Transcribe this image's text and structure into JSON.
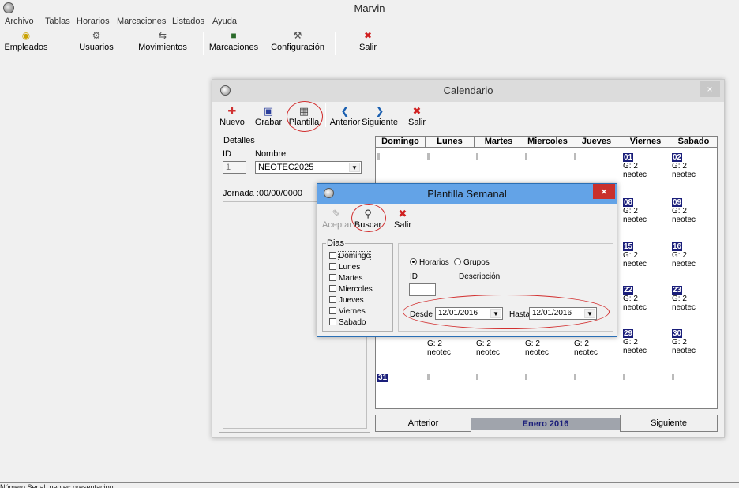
{
  "app": {
    "title": "Marvin"
  },
  "menu": [
    "Archivo",
    "Tablas",
    "Horarios",
    "Marcaciones",
    "Listados",
    "Ayuda"
  ],
  "toolbar": {
    "empleados": "Empleados",
    "usuarios": "Usuarios",
    "movimientos": "Movimientos",
    "marcaciones": "Marcaciones",
    "configuracion": "Configuración",
    "salir": "Salir"
  },
  "calendario": {
    "title": "Calendario",
    "close": "×",
    "toolbar": {
      "nuevo": "Nuevo",
      "grabar": "Grabar",
      "plantilla": "Plantilla",
      "anterior": "Anterior",
      "siguiente": "Siguiente",
      "salir": "Salir"
    },
    "detalles": {
      "title": "Detalles",
      "id_label": "ID",
      "nombre_label": "Nombre",
      "id_value": "1",
      "nombre_value": "NEOTEC2025",
      "jornada_label": "Jornada :",
      "jornada_value": "00/00/0000"
    },
    "days": [
      "Domingo",
      "Lunes",
      "Martes",
      "Miercoles",
      "Jueves",
      "Viernes",
      "Sabado"
    ],
    "cells": {
      "d01": "01",
      "d02": "02",
      "d08": "08",
      "d09": "09",
      "d15": "15",
      "d16": "16",
      "d22": "22",
      "d23": "23",
      "d29": "29",
      "d30": "30",
      "d31": "31",
      "g": "G: 2",
      "emp": "neotec"
    },
    "footer": {
      "anterior": "Anterior",
      "month": "Enero 2016",
      "siguiente": "Siguiente"
    }
  },
  "plantilla": {
    "title": "Plantilla Semanal",
    "close": "×",
    "toolbar": {
      "aceptar": "Aceptar",
      "buscar": "Buscar",
      "salir": "Salir"
    },
    "dias": {
      "title": "Dias",
      "items": [
        "Domingo",
        "Lunes",
        "Martes",
        "Miercoles",
        "Jueves",
        "Viernes",
        "Sabado"
      ]
    },
    "radio": {
      "horarios": "Horarios",
      "grupos": "Grupos",
      "selected": "Horarios"
    },
    "id_label": "ID",
    "descripcion_label": "Descripción",
    "id_value": "",
    "desde_label": "Desde",
    "desde_value": "12/01/2016",
    "hasta_label": "Hasta",
    "hasta_value": "12/01/2016"
  },
  "status": {
    "text": "Número Serial: neotec presentacion"
  }
}
